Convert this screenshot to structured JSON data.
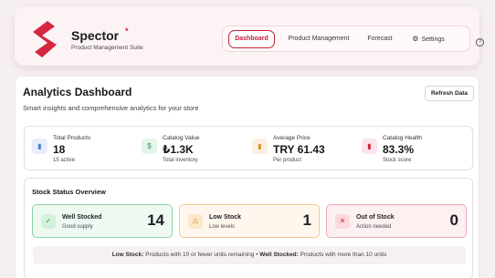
{
  "brand": {
    "name": "Spector",
    "star": "*",
    "subtitle": "Product Management Suite",
    "logo_color": "#d4273f"
  },
  "nav": {
    "items": [
      {
        "label": "Dashboard",
        "active": true
      },
      {
        "label": "Product Management",
        "active": false
      },
      {
        "label": "Forecast",
        "active": false
      },
      {
        "label": "Settings",
        "active": false,
        "icon": "gear-icon"
      }
    ],
    "help_icon": "help-circle-icon"
  },
  "dashboard": {
    "title": "Analytics Dashboard",
    "subtitle": "Smart insights and comprehensive analytics for your store",
    "refresh_label": "Refresh Data"
  },
  "stats": [
    {
      "label": "Total Products",
      "value": "18",
      "sub": "15 active",
      "icon": "bar-chart-icon",
      "color": "#4a7fd9",
      "bg": "#e8eefb"
    },
    {
      "label": "Catalog Value",
      "value": "₺1.3K",
      "sub": "Total inventory",
      "icon": "dollar-icon",
      "color": "#2e9b55",
      "bg": "#e3f4e9"
    },
    {
      "label": "Average Price",
      "value": "TRY 61.43",
      "sub": "Per product",
      "icon": "chart-icon",
      "color": "#d9902b",
      "bg": "#fbf0df"
    },
    {
      "label": "Catalog Health",
      "value": "83.3%",
      "sub": "Stock score",
      "icon": "health-chart-icon",
      "color": "#d4273f",
      "bg": "#fbe5e8"
    }
  ],
  "stock": {
    "title": "Stock Status Overview",
    "cards": [
      {
        "label": "Well Stocked",
        "sub": "Good supply",
        "count": "14",
        "icon": "check-icon",
        "glyph": "✓",
        "color": "#2e9b55",
        "bg": "#eef9f1",
        "border": "#8fd3a6"
      },
      {
        "label": "Low Stock",
        "sub": "Low levels",
        "count": "1",
        "icon": "warning-icon",
        "glyph": "⚠",
        "color": "#d9902b",
        "bg": "#fff7ee",
        "border": "#f3c995"
      },
      {
        "label": "Out of Stock",
        "sub": "Action needed",
        "count": "0",
        "icon": "x-icon",
        "glyph": "✕",
        "color": "#d4273f",
        "bg": "#fdf0f1",
        "border": "#f1a8b2"
      }
    ],
    "note": {
      "low_label": "Low Stock:",
      "low_text": " Products with 10 or fewer units remaining • ",
      "well_label": "Well Stocked:",
      "well_text": " Products with more than 10 units"
    }
  }
}
